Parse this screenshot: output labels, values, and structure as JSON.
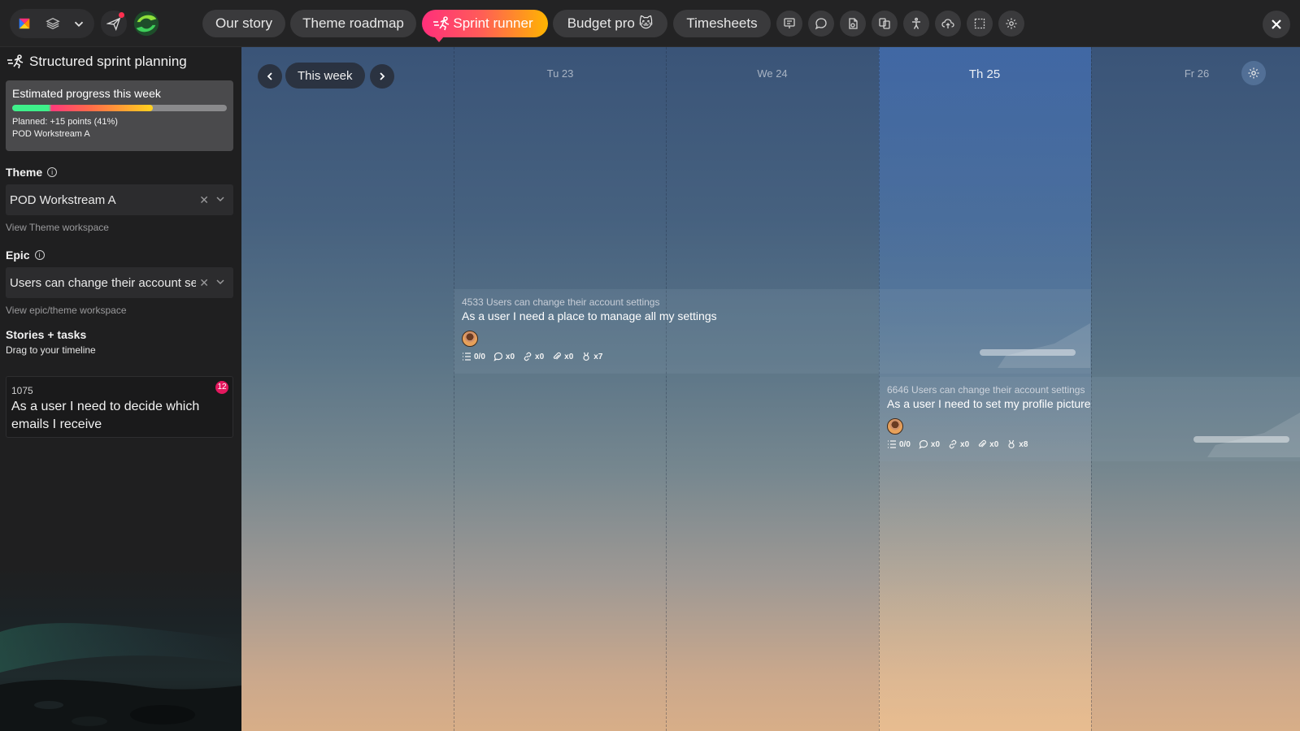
{
  "topbar": {
    "tabs": [
      {
        "label": "Our story",
        "active": false
      },
      {
        "label": "Theme roadmap",
        "active": false
      },
      {
        "label": "Sprint runner",
        "active": true
      },
      {
        "label": "Budget pro 🐱",
        "active": false
      },
      {
        "label": "Timesheets",
        "active": false
      }
    ],
    "tool_icons": [
      "presentation-icon",
      "chat-icon",
      "document-icon",
      "compare-icon",
      "accessibility-icon",
      "cloud-upload-icon",
      "selection-icon",
      "settings-icon"
    ],
    "accent_gradient": [
      "#ff2f7b",
      "#ffb500"
    ]
  },
  "sidebar": {
    "title": "Structured sprint planning",
    "progress": {
      "title": "Estimated progress this week",
      "percent": 41,
      "planned_text": "Planned: +15 points (41%)",
      "workstream": "POD Workstream A"
    },
    "theme": {
      "label": "Theme",
      "value": "POD Workstream A",
      "link": "View Theme workspace"
    },
    "epic": {
      "label": "Epic",
      "value": "Users can change their account settings",
      "link": "View epic/theme workspace"
    },
    "stories": {
      "label": "Stories + tasks",
      "subtitle": "Drag to your timeline",
      "items": [
        {
          "id": "1075",
          "text": "As a user I need to decide which emails I receive",
          "badge": "12"
        }
      ]
    }
  },
  "timeline": {
    "week_label": "This week",
    "days": [
      {
        "label": "",
        "today": false
      },
      {
        "label": "Tu 23",
        "today": false
      },
      {
        "label": "We 24",
        "today": false
      },
      {
        "label": "Th 25",
        "today": true
      },
      {
        "label": "Fr 26",
        "today": false
      }
    ],
    "tasks": [
      {
        "epic_line": "4533 Users can change their account settings",
        "title": "As a user I need a place to manage all my settings",
        "checklist": "0/0",
        "comments": "x0",
        "links": "x0",
        "attachments": "x0",
        "points": "x7"
      },
      {
        "epic_line": "6646 Users can change their account settings",
        "title": "As a user I need to set my profile picture",
        "checklist": "0/0",
        "comments": "x0",
        "links": "x0",
        "attachments": "x0",
        "points": "x8"
      }
    ]
  }
}
